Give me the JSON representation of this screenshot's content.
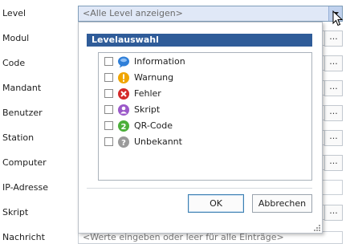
{
  "labels": [
    "Level",
    "Modul",
    "Code",
    "Mandant",
    "Benutzer",
    "Station",
    "Computer",
    "IP-Adresse",
    "Skript",
    "Nachricht"
  ],
  "level_select": {
    "value": "<Alle Level anzeigen>"
  },
  "nachricht_placeholder": "<Werte eingeben oder leer für alle Einträge>",
  "dots_label": "...",
  "popup": {
    "title": "Levelauswahl",
    "items": [
      {
        "label": "Information",
        "icon": "information-icon",
        "color": "#2f7fd8",
        "checked": false
      },
      {
        "label": "Warnung",
        "icon": "warning-icon",
        "color": "#f0a500",
        "checked": false
      },
      {
        "label": "Fehler",
        "icon": "error-icon",
        "color": "#d42a2a",
        "checked": false
      },
      {
        "label": "Skript",
        "icon": "script-icon",
        "color": "#9b59c9",
        "checked": false
      },
      {
        "label": "QR-Code",
        "icon": "qr-code-icon",
        "color": "#4caf3a",
        "checked": false
      },
      {
        "label": "Unbekannt",
        "icon": "unknown-icon",
        "color": "#9a9a9a",
        "checked": false
      }
    ],
    "ok_label": "OK",
    "cancel_label": "Abbrechen"
  }
}
